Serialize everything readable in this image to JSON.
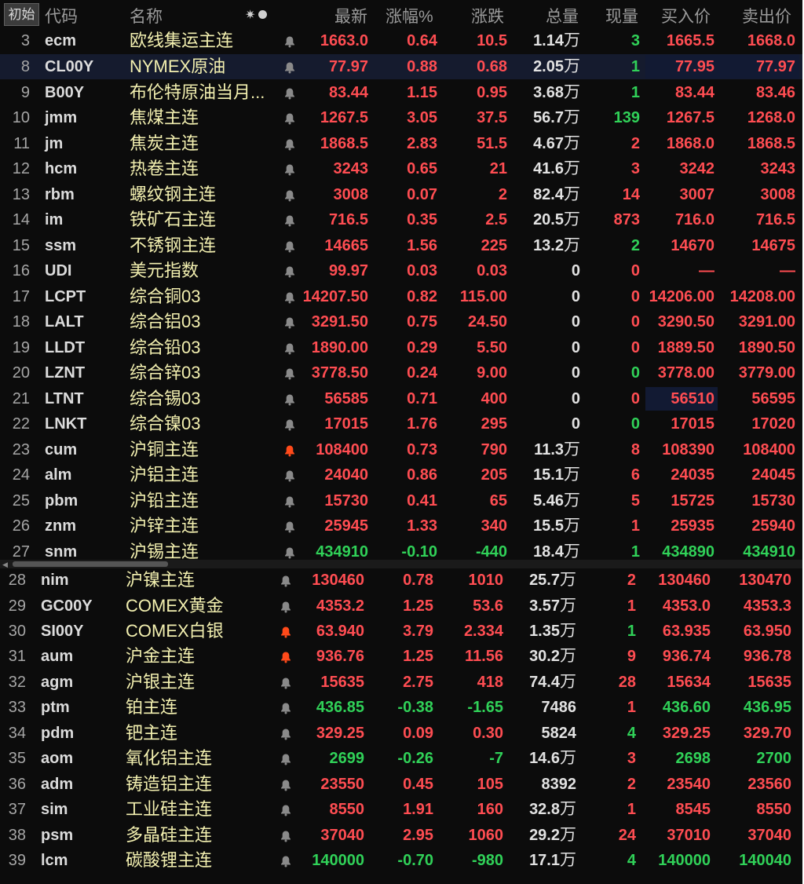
{
  "header": {
    "init_label": "初始",
    "col_code": "代码",
    "col_name": "名称",
    "col_last": "最新",
    "col_pct": "涨幅%",
    "col_chg": "涨跌",
    "col_vol": "总量",
    "col_cur": "现量",
    "col_bid": "买入价",
    "col_ask": "卖出价",
    "icons": [
      "sun-icon",
      "dot-icon",
      "bell-icon"
    ]
  },
  "colors": {
    "up": "#ff4d52",
    "down": "#30d158",
    "name": "#f3f0b0",
    "bell_active": "#ff4a1a",
    "bell_inactive": "#8a8a8a"
  },
  "rows": [
    {
      "idx": "3",
      "code": "ecm",
      "name": "欧线集运主连",
      "last": "1663.0",
      "pct": "0.64",
      "chg": "10.5",
      "vol": "1.14",
      "unit": "万",
      "cur": "3",
      "bid": "1665.5",
      "ask": "1668.0",
      "dir": "up",
      "cur_dir": "down",
      "bell": "off"
    },
    {
      "idx": "8",
      "code": "CL00Y",
      "name": "NYMEX原油",
      "last": "77.97",
      "pct": "0.88",
      "chg": "0.68",
      "vol": "2.05",
      "unit": "万",
      "cur": "1",
      "bid": "77.95",
      "ask": "77.97",
      "dir": "up",
      "cur_dir": "down",
      "bell": "off",
      "selected": true
    },
    {
      "idx": "9",
      "code": "B00Y",
      "name": "布伦特原油当月...",
      "last": "83.44",
      "pct": "1.15",
      "chg": "0.95",
      "vol": "3.68",
      "unit": "万",
      "cur": "1",
      "bid": "83.44",
      "ask": "83.46",
      "dir": "up",
      "cur_dir": "down",
      "bell": "off"
    },
    {
      "idx": "10",
      "code": "jmm",
      "name": "焦煤主连",
      "last": "1267.5",
      "pct": "3.05",
      "chg": "37.5",
      "vol": "56.7",
      "unit": "万",
      "cur": "139",
      "bid": "1267.5",
      "ask": "1268.0",
      "dir": "up",
      "cur_dir": "down",
      "bell": "off"
    },
    {
      "idx": "11",
      "code": "jm",
      "name": "焦炭主连",
      "last": "1868.5",
      "pct": "2.83",
      "chg": "51.5",
      "vol": "4.67",
      "unit": "万",
      "cur": "2",
      "bid": "1868.0",
      "ask": "1868.5",
      "dir": "up",
      "cur_dir": "up",
      "bell": "off"
    },
    {
      "idx": "12",
      "code": "hcm",
      "name": "热卷主连",
      "last": "3243",
      "pct": "0.65",
      "chg": "21",
      "vol": "41.6",
      "unit": "万",
      "cur": "3",
      "bid": "3242",
      "ask": "3243",
      "dir": "up",
      "cur_dir": "up",
      "bell": "off"
    },
    {
      "idx": "13",
      "code": "rbm",
      "name": "螺纹钢主连",
      "last": "3008",
      "pct": "0.07",
      "chg": "2",
      "vol": "82.4",
      "unit": "万",
      "cur": "14",
      "bid": "3007",
      "ask": "3008",
      "dir": "up",
      "cur_dir": "up",
      "bell": "off"
    },
    {
      "idx": "14",
      "code": "im",
      "name": "铁矿石主连",
      "last": "716.5",
      "pct": "0.35",
      "chg": "2.5",
      "vol": "20.5",
      "unit": "万",
      "cur": "873",
      "bid": "716.0",
      "ask": "716.5",
      "dir": "up",
      "cur_dir": "up",
      "bell": "off"
    },
    {
      "idx": "15",
      "code": "ssm",
      "name": "不锈钢主连",
      "last": "14665",
      "pct": "1.56",
      "chg": "225",
      "vol": "13.2",
      "unit": "万",
      "cur": "2",
      "bid": "14670",
      "ask": "14675",
      "dir": "up",
      "cur_dir": "down",
      "bell": "off"
    },
    {
      "idx": "16",
      "code": "UDI",
      "name": "美元指数",
      "last": "99.97",
      "pct": "0.03",
      "chg": "0.03",
      "vol": "0",
      "unit": "",
      "cur": "0",
      "bid": "—",
      "ask": "—",
      "dir": "up",
      "cur_dir": "up",
      "bell": "off"
    },
    {
      "idx": "17",
      "code": "LCPT",
      "name": "综合铜03",
      "last": "14207.50",
      "pct": "0.82",
      "chg": "115.00",
      "vol": "0",
      "unit": "",
      "cur": "0",
      "bid": "14206.00",
      "ask": "14208.00",
      "dir": "up",
      "cur_dir": "up",
      "bell": "off"
    },
    {
      "idx": "18",
      "code": "LALT",
      "name": "综合铝03",
      "last": "3291.50",
      "pct": "0.75",
      "chg": "24.50",
      "vol": "0",
      "unit": "",
      "cur": "0",
      "bid": "3290.50",
      "ask": "3291.00",
      "dir": "up",
      "cur_dir": "up",
      "bell": "off"
    },
    {
      "idx": "19",
      "code": "LLDT",
      "name": "综合铅03",
      "last": "1890.00",
      "pct": "0.29",
      "chg": "5.50",
      "vol": "0",
      "unit": "",
      "cur": "0",
      "bid": "1889.50",
      "ask": "1890.50",
      "dir": "up",
      "cur_dir": "up",
      "bell": "off"
    },
    {
      "idx": "20",
      "code": "LZNT",
      "name": "综合锌03",
      "last": "3778.50",
      "pct": "0.24",
      "chg": "9.00",
      "vol": "0",
      "unit": "",
      "cur": "0",
      "bid": "3778.00",
      "ask": "3779.00",
      "dir": "up",
      "cur_dir": "down",
      "bell": "off"
    },
    {
      "idx": "21",
      "code": "LTNT",
      "name": "综合锡03",
      "last": "56585",
      "pct": "0.71",
      "chg": "400",
      "vol": "0",
      "unit": "",
      "cur": "0",
      "bid": "56510",
      "ask": "56595",
      "dir": "up",
      "cur_dir": "up",
      "bell": "off",
      "bid_hl": true
    },
    {
      "idx": "22",
      "code": "LNKT",
      "name": "综合镍03",
      "last": "17015",
      "pct": "1.76",
      "chg": "295",
      "vol": "0",
      "unit": "",
      "cur": "0",
      "bid": "17015",
      "ask": "17020",
      "dir": "up",
      "cur_dir": "down",
      "bell": "off"
    },
    {
      "idx": "23",
      "code": "cum",
      "name": "沪铜主连",
      "last": "108400",
      "pct": "0.73",
      "chg": "790",
      "vol": "11.3",
      "unit": "万",
      "cur": "8",
      "bid": "108390",
      "ask": "108400",
      "dir": "up",
      "cur_dir": "up",
      "bell": "on"
    },
    {
      "idx": "24",
      "code": "alm",
      "name": "沪铝主连",
      "last": "24040",
      "pct": "0.86",
      "chg": "205",
      "vol": "15.1",
      "unit": "万",
      "cur": "6",
      "bid": "24035",
      "ask": "24045",
      "dir": "up",
      "cur_dir": "up",
      "bell": "off"
    },
    {
      "idx": "25",
      "code": "pbm",
      "name": "沪铅主连",
      "last": "15730",
      "pct": "0.41",
      "chg": "65",
      "vol": "5.46",
      "unit": "万",
      "cur": "5",
      "bid": "15725",
      "ask": "15730",
      "dir": "up",
      "cur_dir": "up",
      "bell": "off"
    },
    {
      "idx": "26",
      "code": "znm",
      "name": "沪锌主连",
      "last": "25945",
      "pct": "1.33",
      "chg": "340",
      "vol": "15.5",
      "unit": "万",
      "cur": "1",
      "bid": "25935",
      "ask": "25940",
      "dir": "up",
      "cur_dir": "up",
      "bell": "off"
    },
    {
      "idx": "27",
      "code": "snm",
      "name": "沪锡主连",
      "last": "434910",
      "pct": "-0.10",
      "chg": "-440",
      "vol": "18.4",
      "unit": "万",
      "cur": "1",
      "bid": "434890",
      "ask": "434910",
      "dir": "down",
      "cur_dir": "down",
      "bell": "off"
    },
    {
      "idx": "28",
      "code": "nim",
      "name": "沪镍主连",
      "last": "130460",
      "pct": "0.78",
      "chg": "1010",
      "vol": "25.7",
      "unit": "万",
      "cur": "2",
      "bid": "130460",
      "ask": "130470",
      "dir": "up",
      "cur_dir": "up",
      "bell": "off"
    },
    {
      "idx": "29",
      "code": "GC00Y",
      "name": "COMEX黄金",
      "last": "4353.2",
      "pct": "1.25",
      "chg": "53.6",
      "vol": "3.57",
      "unit": "万",
      "cur": "1",
      "bid": "4353.0",
      "ask": "4353.3",
      "dir": "up",
      "cur_dir": "up",
      "bell": "off"
    },
    {
      "idx": "30",
      "code": "SI00Y",
      "name": "COMEX白银",
      "last": "63.940",
      "pct": "3.79",
      "chg": "2.334",
      "vol": "1.35",
      "unit": "万",
      "cur": "1",
      "bid": "63.935",
      "ask": "63.950",
      "dir": "up",
      "cur_dir": "down",
      "bell": "on"
    },
    {
      "idx": "31",
      "code": "aum",
      "name": "沪金主连",
      "last": "936.76",
      "pct": "1.25",
      "chg": "11.56",
      "vol": "30.2",
      "unit": "万",
      "cur": "9",
      "bid": "936.74",
      "ask": "936.78",
      "dir": "up",
      "cur_dir": "up",
      "bell": "on"
    },
    {
      "idx": "32",
      "code": "agm",
      "name": "沪银主连",
      "last": "15635",
      "pct": "2.75",
      "chg": "418",
      "vol": "74.4",
      "unit": "万",
      "cur": "28",
      "bid": "15634",
      "ask": "15635",
      "dir": "up",
      "cur_dir": "up",
      "bell": "off"
    },
    {
      "idx": "33",
      "code": "ptm",
      "name": "铂主连",
      "last": "436.85",
      "pct": "-0.38",
      "chg": "-1.65",
      "vol": "7486",
      "unit": "",
      "cur": "1",
      "bid": "436.60",
      "ask": "436.95",
      "dir": "down",
      "cur_dir": "up",
      "bell": "off"
    },
    {
      "idx": "34",
      "code": "pdm",
      "name": "钯主连",
      "last": "329.25",
      "pct": "0.09",
      "chg": "0.30",
      "vol": "5824",
      "unit": "",
      "cur": "4",
      "bid": "329.25",
      "ask": "329.70",
      "dir": "up",
      "cur_dir": "down",
      "bell": "off"
    },
    {
      "idx": "35",
      "code": "aom",
      "name": "氧化铝主连",
      "last": "2699",
      "pct": "-0.26",
      "chg": "-7",
      "vol": "14.6",
      "unit": "万",
      "cur": "3",
      "bid": "2698",
      "ask": "2700",
      "dir": "down",
      "cur_dir": "up",
      "bell": "off"
    },
    {
      "idx": "36",
      "code": "adm",
      "name": "铸造铝主连",
      "last": "23550",
      "pct": "0.45",
      "chg": "105",
      "vol": "8392",
      "unit": "",
      "cur": "2",
      "bid": "23540",
      "ask": "23560",
      "dir": "up",
      "cur_dir": "up",
      "bell": "off"
    },
    {
      "idx": "37",
      "code": "sim",
      "name": "工业硅主连",
      "last": "8550",
      "pct": "1.91",
      "chg": "160",
      "vol": "32.8",
      "unit": "万",
      "cur": "1",
      "bid": "8545",
      "ask": "8550",
      "dir": "up",
      "cur_dir": "up",
      "bell": "off"
    },
    {
      "idx": "38",
      "code": "psm",
      "name": "多晶硅主连",
      "last": "37040",
      "pct": "2.95",
      "chg": "1060",
      "vol": "29.2",
      "unit": "万",
      "cur": "24",
      "bid": "37010",
      "ask": "37040",
      "dir": "up",
      "cur_dir": "up",
      "bell": "off"
    },
    {
      "idx": "39",
      "code": "lcm",
      "name": "碳酸锂主连",
      "last": "140000",
      "pct": "-0.70",
      "chg": "-980",
      "vol": "17.1",
      "unit": "万",
      "cur": "4",
      "bid": "140000",
      "ask": "140040",
      "dir": "down",
      "cur_dir": "down",
      "bell": "off"
    }
  ]
}
